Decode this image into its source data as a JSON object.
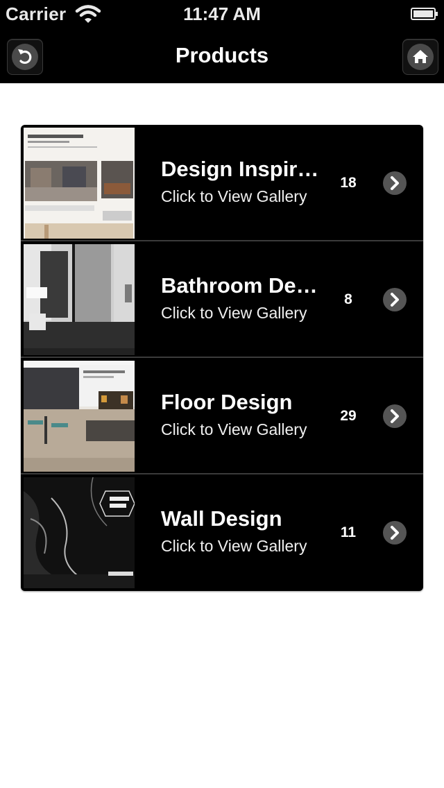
{
  "status_bar": {
    "carrier": "Carrier",
    "time": "11:47 AM",
    "wifi_icon": "wifi-icon",
    "battery_icon": "battery-icon"
  },
  "nav_bar": {
    "title": "Products",
    "back_icon": "back-arrow-icon",
    "home_icon": "home-icon"
  },
  "products": [
    {
      "title": "Design Inspiration",
      "subtitle": "Click to View Gallery",
      "count": "18"
    },
    {
      "title": "Bathroom Design",
      "subtitle": "Click to View Gallery",
      "count": "8"
    },
    {
      "title": "Floor Design",
      "subtitle": "Click to View Gallery",
      "count": "29"
    },
    {
      "title": "Wall Design",
      "subtitle": "Click to View Gallery",
      "count": "11"
    }
  ],
  "colors": {
    "bar_background": "#000000",
    "list_background": "#000000",
    "page_background": "#ffffff",
    "chevron_circle": "#555555"
  }
}
